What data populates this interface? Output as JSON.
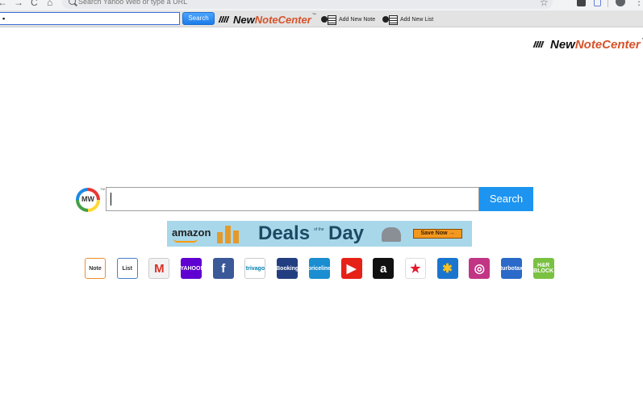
{
  "browser": {
    "nav": {
      "back": "←",
      "forward": "→",
      "reload": "C",
      "home": "⌂"
    },
    "address_placeholder": "Search Yahoo Web or type a URL",
    "icons": [
      "star-icon",
      "extension-icon",
      "extension-icon",
      "profile-icon",
      "menu-icon"
    ]
  },
  "toolbar": {
    "input_value": "▪",
    "search_label": "Search",
    "logo_new": "New",
    "logo_note_center": "NoteCenter",
    "logo_tm": "™",
    "add_note_label": "Add New Note",
    "add_list_label": "Add New List"
  },
  "page": {
    "logo_new": "New",
    "logo_note_center": "NoteCenter",
    "logo_tm": "™",
    "mw_logo_text": "MW",
    "mw_logo_tm": "TM",
    "search_value": "",
    "search_button": "Search",
    "banner": {
      "brand": "amazon",
      "deals": "Deals",
      "of_the": "of the",
      "day": "Day",
      "cta": "Save Now →"
    },
    "quick_links": [
      {
        "name": "note-link",
        "label": "Note",
        "bg": "#ffffff",
        "fg": "#333333",
        "border": "#e7902c"
      },
      {
        "name": "list-link",
        "label": "List",
        "bg": "#ffffff",
        "fg": "#333333",
        "border": "#4a7fc1"
      },
      {
        "name": "gmail-link",
        "label": "M",
        "bg": "#f2f2f2",
        "fg": "#d93025",
        "border": "#cccccc"
      },
      {
        "name": "yahoo-link",
        "label": "YAHOO!",
        "bg": "#5f01d1",
        "fg": "#ffffff",
        "border": ""
      },
      {
        "name": "facebook-link",
        "label": "f",
        "bg": "#3b5998",
        "fg": "#ffffff",
        "border": ""
      },
      {
        "name": "trivago-link",
        "label": "trivago",
        "bg": "#ffffff",
        "fg": "#007faf",
        "border": "#cccccc"
      },
      {
        "name": "booking-link",
        "label": "Booking",
        "bg": "#223e80",
        "fg": "#ffffff",
        "border": ""
      },
      {
        "name": "priceline-link",
        "label": "priceline",
        "bg": "#1a8ed0",
        "fg": "#ffffff",
        "border": ""
      },
      {
        "name": "youtube-link",
        "label": "▶",
        "bg": "#e62117",
        "fg": "#ffffff",
        "border": ""
      },
      {
        "name": "amazon-link",
        "label": "a",
        "bg": "#111111",
        "fg": "#ffffff",
        "border": ""
      },
      {
        "name": "macys-link",
        "label": "★",
        "bg": "#ffffff",
        "fg": "#e21a2c",
        "border": "#dddddd"
      },
      {
        "name": "walmart-link",
        "label": "✱",
        "bg": "#1a75cf",
        "fg": "#ffc220",
        "border": ""
      },
      {
        "name": "instagram-link",
        "label": "◎",
        "bg": "#c13584",
        "fg": "#ffffff",
        "border": ""
      },
      {
        "name": "turbotax-link",
        "label": "turbotax",
        "bg": "#2b6ac8",
        "fg": "#ffffff",
        "border": ""
      },
      {
        "name": "hrblock-link",
        "label": "H&R BLOCK",
        "bg": "#7ac142",
        "fg": "#ffffff",
        "border": ""
      }
    ]
  }
}
